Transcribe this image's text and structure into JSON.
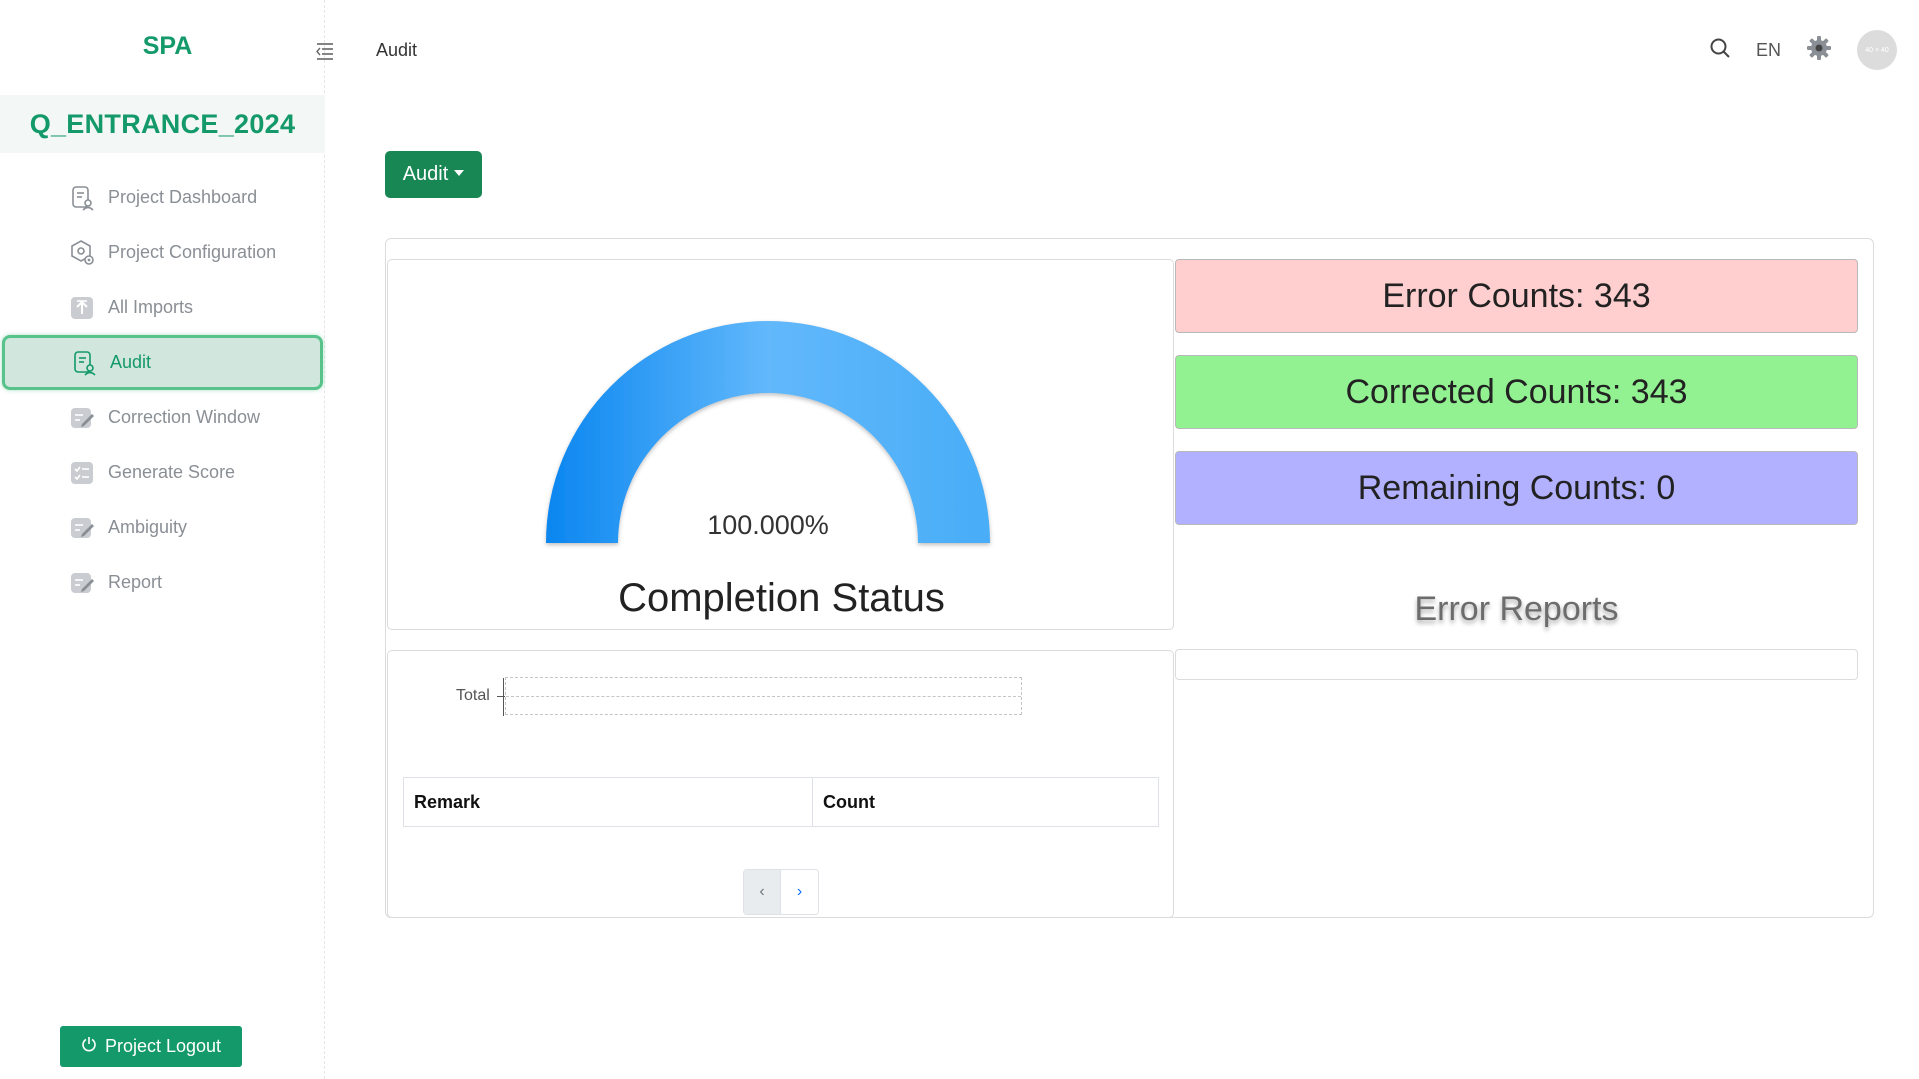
{
  "brand": "SPA",
  "project_name": "Q_ENTRANCE_2024",
  "sidebar": {
    "items": [
      {
        "label": "Project Dashboard",
        "icon": "dashboard-doc-icon"
      },
      {
        "label": "Project Configuration",
        "icon": "config-gear-icon"
      },
      {
        "label": "All Imports",
        "icon": "upload-icon"
      },
      {
        "label": "Audit",
        "icon": "audit-doc-icon",
        "active": true
      },
      {
        "label": "Correction Window",
        "icon": "edit-icon"
      },
      {
        "label": "Generate Score",
        "icon": "checklist-icon"
      },
      {
        "label": "Ambiguity",
        "icon": "edit-icon"
      },
      {
        "label": "Report",
        "icon": "edit-icon"
      }
    ],
    "logout_label": "Project Logout"
  },
  "header": {
    "page_title": "Audit",
    "language": "EN",
    "avatar_text": "40 × 40"
  },
  "main": {
    "audit_button": "Audit",
    "gauge": {
      "percent": 100.0,
      "value_label": "100.000%",
      "title": "Completion Status"
    },
    "counts": {
      "error": "Error Counts: 343",
      "corrected": "Corrected Counts: 343",
      "remaining": "Remaining Counts: 0"
    },
    "error_reports_title": "Error Reports",
    "total_label": "Total",
    "table": {
      "columns": [
        "Remark",
        "Count"
      ],
      "rows": []
    },
    "pager": {
      "prev": "‹",
      "next": "›"
    }
  },
  "colors": {
    "brand_green": "#13996a",
    "button_green": "#198754",
    "error_bg": "#ffcfcf",
    "corrected_bg": "#92f292",
    "remaining_bg": "#b1b1ff",
    "gauge_blue": "#2b9af3"
  }
}
